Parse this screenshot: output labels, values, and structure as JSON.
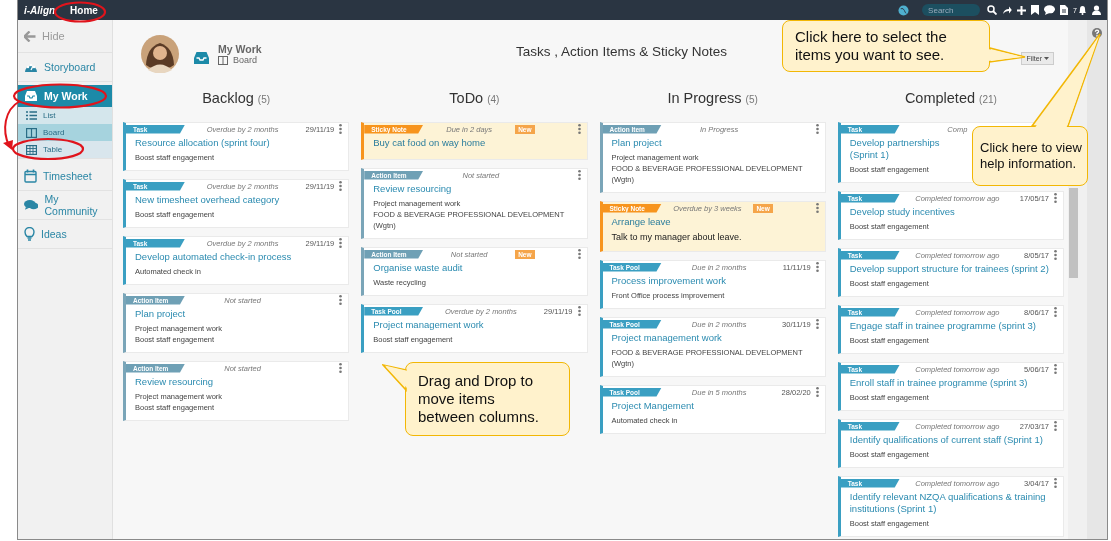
{
  "topbar": {
    "logo": "i-Align",
    "home": "Home",
    "search": {
      "placeholder": "Search"
    },
    "badge": "7"
  },
  "sidebar": {
    "hide": "Hide",
    "items": [
      {
        "label": "Storyboard",
        "selected": false
      },
      {
        "label": "My Work",
        "selected": true,
        "children": [
          {
            "label": "List",
            "selected": false
          },
          {
            "label": "Board",
            "selected": true
          },
          {
            "label": "Table",
            "selected": false
          }
        ]
      },
      {
        "label": "Timesheet",
        "selected": false
      },
      {
        "label": "My Community",
        "selected": false
      },
      {
        "label": "Ideas",
        "selected": false
      }
    ]
  },
  "header": {
    "section": "My Work",
    "view": "Board",
    "title": "Tasks , Action Items & Sticky Notes",
    "filter": "Filter"
  },
  "columns": [
    {
      "title": "Backlog",
      "count": "(5)",
      "cards": [
        {
          "kind": "task",
          "label": "Task",
          "status": "Overdue by 2 months",
          "date": "29/11/19",
          "title": "Resource allocation (sprint four)",
          "lines": [
            "Boost staff engagement"
          ]
        },
        {
          "kind": "task",
          "label": "Task",
          "status": "Overdue by 2 months",
          "date": "29/11/19",
          "title": "New timesheet overhead category",
          "lines": [
            "Boost staff engagement"
          ]
        },
        {
          "kind": "task",
          "label": "Task",
          "status": "Overdue by 2 months",
          "date": "29/11/19",
          "title": "Develop automated check-in process",
          "lines": [
            "Automated check in"
          ]
        },
        {
          "kind": "action",
          "label": "Action Item",
          "status": "Not started",
          "title": "Plan project",
          "lines": [
            "Project management work",
            "Boost staff engagement"
          ]
        },
        {
          "kind": "action",
          "label": "Action Item",
          "status": "Not started",
          "title": "Review resourcing",
          "lines": [
            "Project management work",
            "Boost staff engagement"
          ]
        }
      ]
    },
    {
      "title": "ToDo",
      "count": "(4)",
      "cards": [
        {
          "kind": "sticky",
          "label": "Sticky Note",
          "status": "Due in 2 days",
          "badge": "New",
          "title": "Buy cat food on way home"
        },
        {
          "kind": "action",
          "label": "Action Item",
          "status": "Not started",
          "title": "Review resourcing",
          "lines": [
            "Project management work",
            "FOOD & BEVERAGE PROFESSIONAL DEVELOPMENT (Wgtn)"
          ]
        },
        {
          "kind": "action",
          "label": "Action Item",
          "status": "Not started",
          "badge": "New",
          "title": "Organise waste audit",
          "lines": [
            "Waste recycling"
          ]
        },
        {
          "kind": "pool",
          "label": "Task Pool",
          "status": "Overdue by 2 months",
          "date": "29/11/19",
          "title": "Project management work",
          "lines": [
            "Boost staff engagement"
          ]
        }
      ]
    },
    {
      "title": "In Progress",
      "count": "(5)",
      "cards": [
        {
          "kind": "action",
          "label": "Action Item",
          "status": "In Progress",
          "title": "Plan project",
          "lines": [
            "Project management work",
            "FOOD & BEVERAGE PROFESSIONAL DEVELOPMENT (Wgtn)"
          ]
        },
        {
          "kind": "sticky",
          "label": "Sticky Note",
          "status": "Overdue by 3 weeks",
          "badge": "New",
          "title": "Arrange leave",
          "lines": [
            "Talk to my manager about leave."
          ]
        },
        {
          "kind": "pool",
          "label": "Task Pool",
          "status": "Due in 2 months",
          "date": "11/11/19",
          "title": "Process improvement work",
          "lines": [
            "Front Office process improvement"
          ]
        },
        {
          "kind": "pool",
          "label": "Task Pool",
          "status": "Due in 2 months",
          "date": "30/11/19",
          "title": "Project management work",
          "lines": [
            "FOOD & BEVERAGE PROFESSIONAL DEVELOPMENT (Wgtn)"
          ]
        },
        {
          "kind": "pool",
          "label": "Task Pool",
          "status": "Due in 5 months",
          "date": "28/02/20",
          "title": "Project Mangement",
          "lines": [
            "Automated check in"
          ]
        }
      ]
    },
    {
      "title": "Completed",
      "count": "(21)",
      "cards": [
        {
          "kind": "task",
          "label": "Task",
          "status": "Comp",
          "title": "Develop partnerships\n(Sprint 1)",
          "lines": [
            "Boost staff engagement"
          ]
        },
        {
          "kind": "task",
          "label": "Task",
          "status": "Completed tomorrow ago",
          "date": "17/05/17",
          "title": "Develop study incentives",
          "lines": [
            "Boost staff engagement"
          ]
        },
        {
          "kind": "task",
          "label": "Task",
          "status": "Completed tomorrow ago",
          "date": "8/05/17",
          "title": "Develop support structure for trainees (sprint 2)",
          "lines": [
            "Boost staff engagement"
          ]
        },
        {
          "kind": "task",
          "label": "Task",
          "status": "Completed tomorrow ago",
          "date": "8/06/17",
          "title": "Engage staff in trainee programme (sprint 3)",
          "lines": [
            "Boost staff engagement"
          ]
        },
        {
          "kind": "task",
          "label": "Task",
          "status": "Completed tomorrow ago",
          "date": "5/06/17",
          "title": "Enroll staff in trainee programme (sprint 3)",
          "lines": [
            "Boost staff engagement"
          ]
        },
        {
          "kind": "task",
          "label": "Task",
          "status": "Completed tomorrow ago",
          "date": "27/03/17",
          "title": "Identify qualifications of current staff (Sprint 1)",
          "lines": [
            "Boost staff engagement"
          ]
        },
        {
          "kind": "task",
          "label": "Task",
          "status": "Completed tomorrow ago",
          "date": "3/04/17",
          "title": "Identify relevant NZQA qualifications & training institutions (Sprint 1)",
          "lines": [
            "Boost staff engagement"
          ]
        }
      ]
    }
  ],
  "callouts": [
    {
      "text": "Click here to select the items you want to see."
    },
    {
      "text": "Click here to view help information."
    },
    {
      "text": "Drag and Drop to move items between columns."
    }
  ]
}
